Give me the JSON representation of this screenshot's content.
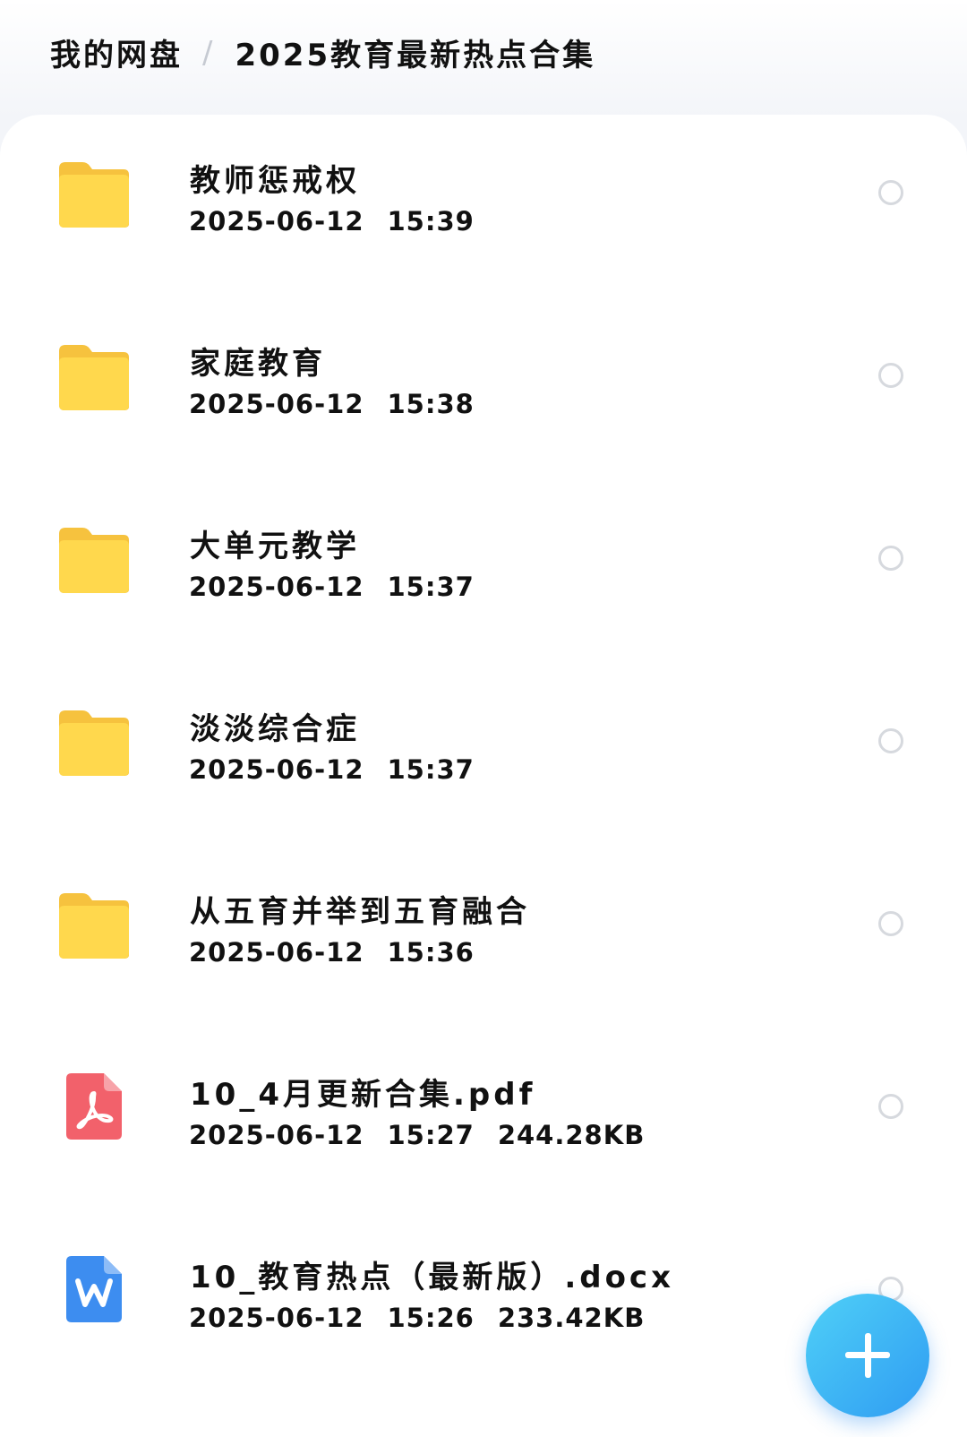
{
  "breadcrumb": {
    "root": "我的网盘",
    "separator": "/",
    "current": "2025教育最新热点合集"
  },
  "files": [
    {
      "name": "教师惩戒权",
      "date": "2025-06-12",
      "time": "15:39",
      "size": "",
      "type": "folder",
      "icon": "folder-icon"
    },
    {
      "name": "家庭教育",
      "date": "2025-06-12",
      "time": "15:38",
      "size": "",
      "type": "folder",
      "icon": "folder-icon"
    },
    {
      "name": "大单元教学",
      "date": "2025-06-12",
      "time": "15:37",
      "size": "",
      "type": "folder",
      "icon": "folder-icon"
    },
    {
      "name": "淡淡综合症",
      "date": "2025-06-12",
      "time": "15:37",
      "size": "",
      "type": "folder",
      "icon": "folder-icon"
    },
    {
      "name": "从五育并举到五育融合",
      "date": "2025-06-12",
      "time": "15:36",
      "size": "",
      "type": "folder",
      "icon": "folder-icon"
    },
    {
      "name": "10_4月更新合集.pdf",
      "date": "2025-06-12",
      "time": "15:27",
      "size": "244.28KB",
      "type": "pdf",
      "icon": "pdf-file-icon"
    },
    {
      "name": "10_教育热点（最新版）.docx",
      "date": "2025-06-12",
      "time": "15:26",
      "size": "233.42KB",
      "type": "docx",
      "icon": "word-file-icon"
    }
  ],
  "fab": {
    "icon": "plus-icon"
  },
  "colors": {
    "folder": "#ffd84d",
    "pdf": "#f2616b",
    "word": "#3d8df0",
    "fab_start": "#4fd0f7",
    "fab_end": "#2f9cf2"
  }
}
